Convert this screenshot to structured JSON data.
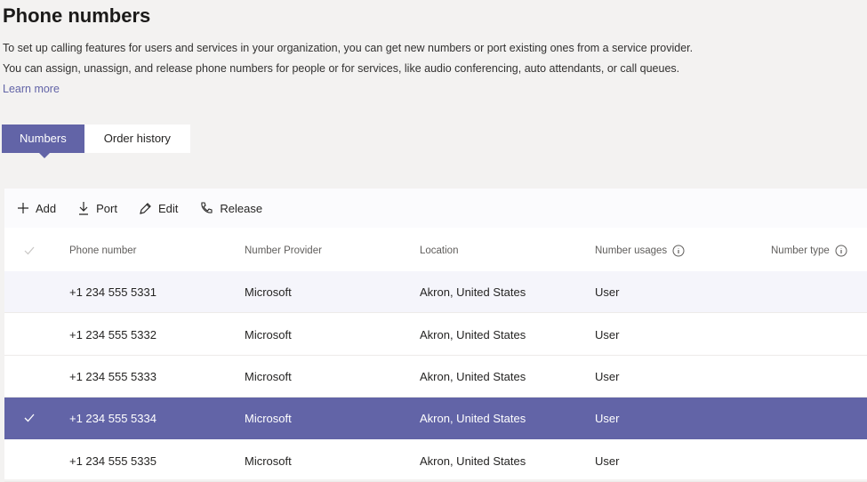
{
  "page": {
    "title": "Phone numbers",
    "description": "To set up calling features for users and services in your organization, you can get new numbers or port existing ones from a service provider. You can assign, unassign, and release phone numbers for people or for services, like audio conferencing, auto attendants, or call queues.",
    "learn_more": "Learn more"
  },
  "tabs": [
    {
      "label": "Numbers",
      "active": true
    },
    {
      "label": "Order history",
      "active": false
    }
  ],
  "toolbar": {
    "add_label": "Add",
    "port_label": "Port",
    "edit_label": "Edit",
    "release_label": "Release"
  },
  "table": {
    "columns": [
      "Phone number",
      "Number Provider",
      "Location",
      "Number usages",
      "Number type"
    ],
    "rows": [
      {
        "phone": "+1 234 555 5331",
        "provider": "Microsoft",
        "location": "Akron, United States",
        "usage": "User",
        "type": "",
        "selected": false
      },
      {
        "phone": "+1 234 555 5332",
        "provider": "Microsoft",
        "location": "Akron, United States",
        "usage": "User",
        "type": "",
        "selected": false
      },
      {
        "phone": "+1 234 555 5333",
        "provider": "Microsoft",
        "location": "Akron, United States",
        "usage": "User",
        "type": "",
        "selected": false
      },
      {
        "phone": "+1 234 555 5334",
        "provider": "Microsoft",
        "location": "Akron, United States",
        "usage": "User",
        "type": "",
        "selected": true
      },
      {
        "phone": "+1 234 555 5335",
        "provider": "Microsoft",
        "location": "Akron, United States",
        "usage": "User",
        "type": "",
        "selected": false
      }
    ]
  },
  "colors": {
    "accent": "#6264a7",
    "background": "#f3f2f1",
    "panel": "#ffffff"
  },
  "icons": {
    "add": "plus-icon",
    "port": "download-arrow-icon",
    "edit": "pencil-icon",
    "release": "phone-icon",
    "info": "info-icon",
    "check": "checkmark-icon"
  }
}
